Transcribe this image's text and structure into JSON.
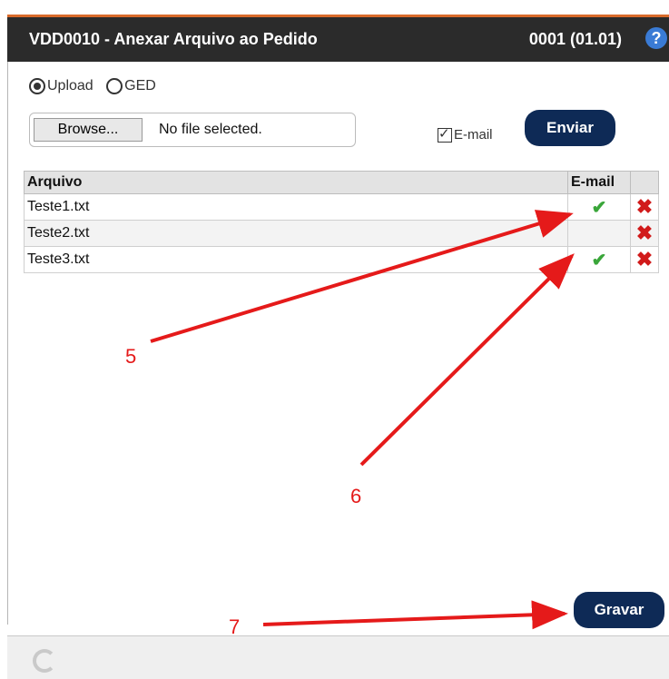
{
  "window": {
    "title": "VDD0010 - Anexar Arquivo ao Pedido",
    "version": "0001 (01.01)",
    "help_icon": "?"
  },
  "source_options": [
    {
      "label": "Upload",
      "selected": true
    },
    {
      "label": "GED",
      "selected": false
    }
  ],
  "file_input": {
    "browse_label": "Browse...",
    "status": "No file selected."
  },
  "email_option": {
    "label": "E-mail",
    "checked": true
  },
  "buttons": {
    "send_label": "Enviar",
    "save_label": "Gravar"
  },
  "table": {
    "columns": [
      "Arquivo",
      "E-mail",
      ""
    ],
    "rows": [
      {
        "file": "Teste1.txt",
        "email": true
      },
      {
        "file": "Teste2.txt",
        "email": false
      },
      {
        "file": "Teste3.txt",
        "email": true
      }
    ]
  },
  "annotations": {
    "a5": "5",
    "a6": "6",
    "a7": "7"
  },
  "colors": {
    "header": "#2b2b2b",
    "accent": "#d86a2a",
    "button": "#0e2a56",
    "annotation": "#e51a1a"
  }
}
